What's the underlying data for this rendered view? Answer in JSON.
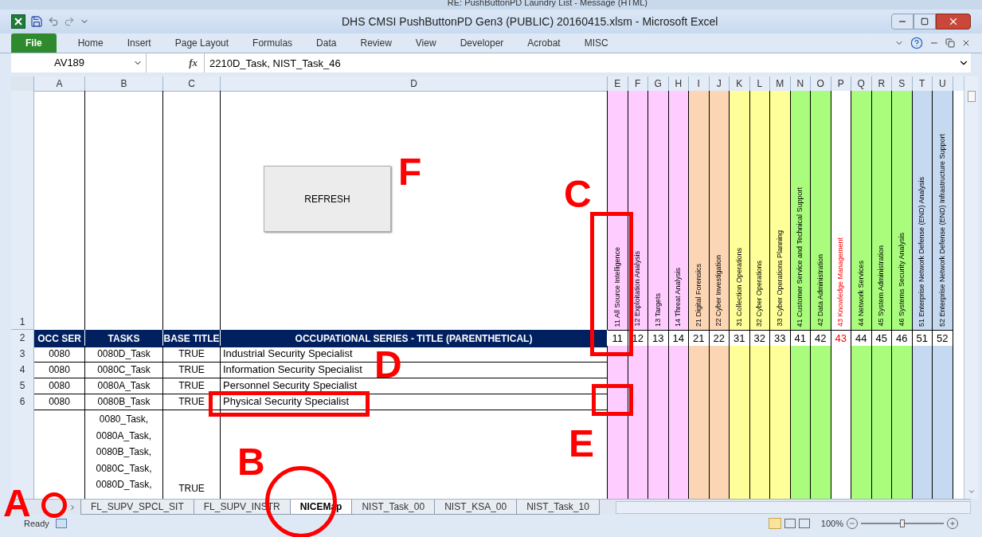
{
  "background_window": {
    "title": "RE: PushButtonPD Laundry List - Message (HTML)"
  },
  "window": {
    "title": "DHS CMSI PushButtonPD Gen3 (PUBLIC) 20160415.xlsm - Microsoft Excel"
  },
  "ribbon_tabs": [
    {
      "label": "File",
      "selected": true
    },
    {
      "label": "Home",
      "selected": false
    },
    {
      "label": "Insert",
      "selected": false
    },
    {
      "label": "Page Layout",
      "selected": false
    },
    {
      "label": "Formulas",
      "selected": false
    },
    {
      "label": "Data",
      "selected": false
    },
    {
      "label": "Review",
      "selected": false
    },
    {
      "label": "View",
      "selected": false
    },
    {
      "label": "Developer",
      "selected": false
    },
    {
      "label": "Acrobat",
      "selected": false
    },
    {
      "label": "MISC",
      "selected": false
    }
  ],
  "formula_bar": {
    "name_box": "AV189",
    "fx": "fx",
    "value": "2210D_Task, NIST_Task_46"
  },
  "columns": [
    "A",
    "B",
    "C",
    "D"
  ],
  "row_numbers": [
    "1",
    "2",
    "3",
    "4",
    "5",
    "6"
  ],
  "refresh_button": "REFRESH",
  "header_row": [
    "OCC SER",
    "TASKS",
    "BASE TITLE",
    "OCCUPATIONAL SERIES - TITLE (PARENTHETICAL)"
  ],
  "rows": [
    [
      "0080",
      "0080D_Task",
      "TRUE",
      "Industrial Security Specialist"
    ],
    [
      "0080",
      "0080C_Task",
      "TRUE",
      "Information Security Specialist"
    ],
    [
      "0080",
      "0080A_Task",
      "TRUE",
      "Personnel Security Specialist"
    ],
    [
      "0080",
      "0080B_Task",
      "TRUE",
      "Physical Security Specialist"
    ]
  ],
  "row_7": {
    "tasks": [
      "0080_Task,",
      "0080A_Task,",
      "0080B_Task,",
      "0080C_Task,",
      "0080D_Task,"
    ],
    "base_title": "TRUE"
  },
  "work_roles": [
    {
      "column": "E",
      "label": "11 All Source Intelligence",
      "number": "11",
      "color": "#ffccff",
      "flagged": false
    },
    {
      "column": "F",
      "label": "12 Exploitation Analysis",
      "number": "12",
      "color": "#ffccff",
      "flagged": false
    },
    {
      "column": "G",
      "label": "13 Targets",
      "number": "13",
      "color": "#ffccff",
      "flagged": false
    },
    {
      "column": "H",
      "label": "14 Threat Analysis",
      "number": "14",
      "color": "#ffccff",
      "flagged": false
    },
    {
      "column": "I",
      "label": "21 Digital Forensics",
      "number": "21",
      "color": "#fcd5b4",
      "flagged": false
    },
    {
      "column": "J",
      "label": "22 Cyber Investigation",
      "number": "22",
      "color": "#fcd5b4",
      "flagged": false
    },
    {
      "column": "K",
      "label": "31 Collection Operations",
      "number": "31",
      "color": "#ffff99",
      "flagged": false
    },
    {
      "column": "L",
      "label": "32 Cyber Operations",
      "number": "32",
      "color": "#ffff99",
      "flagged": false
    },
    {
      "column": "M",
      "label": "33 Cyber Operations Planning",
      "number": "33",
      "color": "#ffff99",
      "flagged": false
    },
    {
      "column": "N",
      "label": "41 Customer Service and Technical Support",
      "number": "41",
      "color": "#a9fc7c",
      "flagged": false
    },
    {
      "column": "O",
      "label": "42 Data Administration",
      "number": "42",
      "color": "#a9fc7c",
      "flagged": false
    },
    {
      "column": "P",
      "label": "43 Knowledge Management",
      "number": "43",
      "color": "#ffffff",
      "flagged": true
    },
    {
      "column": "Q",
      "label": "44 Network Services",
      "number": "44",
      "color": "#a9fc7c",
      "flagged": false
    },
    {
      "column": "R",
      "label": "45 System Administration",
      "number": "45",
      "color": "#a9fc7c",
      "flagged": false
    },
    {
      "column": "S",
      "label": "46 Systems Security Analysis",
      "number": "46",
      "color": "#a9fc7c",
      "flagged": false
    },
    {
      "column": "T",
      "label": "51 Enterprise Network Defense (END) Analysis",
      "number": "51",
      "color": "#c5d9f1",
      "flagged": false
    },
    {
      "column": "U",
      "label": "52 Enterprise Network Defense (END) Infrastructure Support",
      "number": "52",
      "color": "#c5d9f1",
      "flagged": false
    }
  ],
  "sheet_tabs": [
    {
      "label": "FL_SUPV_SPCL_SIT",
      "selected": false
    },
    {
      "label": "FL_SUPV_INSTR",
      "selected": false
    },
    {
      "label": "NICEMap",
      "selected": true
    },
    {
      "label": "NIST_Task_00",
      "selected": false
    },
    {
      "label": "NIST_KSA_00",
      "selected": false
    },
    {
      "label": "NIST_Task_10",
      "selected": false
    }
  ],
  "status_bar": {
    "status": "Ready",
    "zoom": "100%",
    "zoom_slider": {
      "level": 0.5
    }
  },
  "annotations": [
    {
      "text": "F"
    },
    {
      "text": "C"
    },
    {
      "text": "D"
    },
    {
      "text": "E"
    },
    {
      "text": "B"
    },
    {
      "text": "A"
    }
  ]
}
